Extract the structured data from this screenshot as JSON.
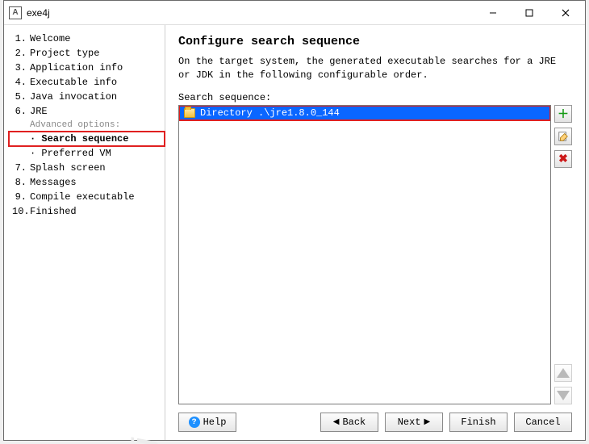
{
  "window": {
    "title": "exe4j",
    "brand": "exe4j"
  },
  "sidebar": {
    "steps": [
      {
        "num": "1.",
        "label": "Welcome"
      },
      {
        "num": "2.",
        "label": "Project type"
      },
      {
        "num": "3.",
        "label": "Application info"
      },
      {
        "num": "4.",
        "label": "Executable info"
      },
      {
        "num": "5.",
        "label": "Java invocation"
      },
      {
        "num": "6.",
        "label": "JRE"
      }
    ],
    "advanced_label": "Advanced options:",
    "substeps": [
      {
        "label": "Search sequence",
        "current": true
      },
      {
        "label": "Preferred VM",
        "current": false
      }
    ],
    "steps2": [
      {
        "num": "7.",
        "label": "Splash screen"
      },
      {
        "num": "8.",
        "label": "Messages"
      },
      {
        "num": "9.",
        "label": "Compile executable"
      },
      {
        "num": "10.",
        "label": "Finished"
      }
    ]
  },
  "main": {
    "heading": "Configure search sequence",
    "description": "On the target system, the generated executable searches for a JRE or JDK in the following configurable order.",
    "seq_label": "Search sequence:",
    "entries": [
      {
        "type": "Directory",
        "path": ".\\jre1.8.0_144"
      }
    ]
  },
  "buttons": {
    "help": "Help",
    "back": "Back",
    "next": "Next",
    "finish": "Finish",
    "cancel": "Cancel"
  }
}
